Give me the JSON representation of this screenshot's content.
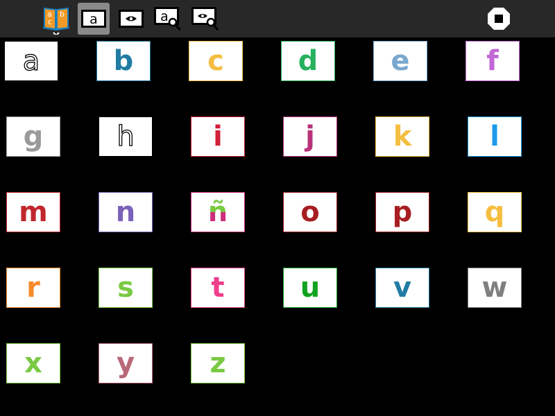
{
  "toolbar": {
    "tools": [
      {
        "id": "activity",
        "icon": "activity-abc-book-icon"
      },
      {
        "id": "letter",
        "icon": "letter-a-icon",
        "label": "a",
        "active": true
      },
      {
        "id": "eye",
        "icon": "eye-icon"
      },
      {
        "id": "letter-search",
        "icon": "letter-search-icon",
        "label": "a"
      },
      {
        "id": "eye-search",
        "icon": "eye-search-icon"
      },
      {
        "id": "stop",
        "icon": "stop-icon"
      }
    ]
  },
  "letters": [
    {
      "char": "a",
      "color": "#ffffff",
      "outline": true
    },
    {
      "char": "b",
      "color": "#217ca3"
    },
    {
      "char": "c",
      "color": "#f5be41"
    },
    {
      "char": "d",
      "color": "#27b15f"
    },
    {
      "char": "e",
      "color": "#78a8cf"
    },
    {
      "char": "f",
      "color": "#c267d6"
    },
    {
      "char": "g",
      "color": "#9a9a9a"
    },
    {
      "char": "h",
      "color": "#ffffff",
      "outline": true
    },
    {
      "char": "i",
      "color": "#d0203a"
    },
    {
      "char": "j",
      "color": "#b8337a"
    },
    {
      "char": "k",
      "color": "#f5be41"
    },
    {
      "char": "l",
      "color": "#1c9be8"
    },
    {
      "char": "m",
      "color": "#c0272d"
    },
    {
      "char": "n",
      "color": "#7a62b8"
    },
    {
      "char": "ñ",
      "color": "#cc2e7a",
      "accent_color": "#7ac943"
    },
    {
      "char": "o",
      "color": "#a61e22"
    },
    {
      "char": "p",
      "color": "#a61e22"
    },
    {
      "char": "q",
      "color": "#f5be41"
    },
    {
      "char": "r",
      "color": "#f58a2a"
    },
    {
      "char": "s",
      "color": "#7ac943"
    },
    {
      "char": "t",
      "color": "#ee3f8c"
    },
    {
      "char": "u",
      "color": "#12a321"
    },
    {
      "char": "v",
      "color": "#217ca3"
    },
    {
      "char": "w",
      "color": "#808080"
    },
    {
      "char": "x",
      "color": "#7ac943"
    },
    {
      "char": "y",
      "color": "#b86877"
    },
    {
      "char": "z",
      "color": "#7ac943"
    }
  ]
}
